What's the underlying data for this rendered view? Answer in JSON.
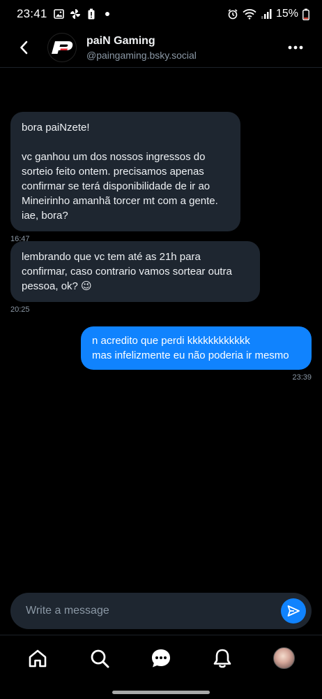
{
  "status_bar": {
    "time": "23:41",
    "battery_percent": "15%",
    "left_icons": [
      "gallery-icon",
      "pinwheel-icon",
      "battery-alert-icon",
      "dot-icon"
    ],
    "right_icons": [
      "alarm-icon",
      "wifi-icon",
      "signal-icon",
      "battery-icon"
    ]
  },
  "header": {
    "name": "paiN Gaming",
    "handle": "@paingaming.bsky.social",
    "logo_text": "P"
  },
  "messages": [
    {
      "direction": "incoming",
      "text": "bora paiNzete!\n\nvc ganhou um dos nossos ingressos do sorteio feito ontem. precisamos apenas confirmar se terá disponibilidade de ir ao Mineirinho amanhã torcer mt com a gente. iae, bora?",
      "time": "16:47"
    },
    {
      "direction": "incoming",
      "text": "lembrando que vc tem até as 21h para confirmar, caso contrario vamos sortear outra pessoa, ok? 😉",
      "time": "20:25"
    },
    {
      "direction": "outgoing",
      "text": "n acredito que perdi kkkkkkkkkkkk\nmas infelizmente eu não poderia ir mesmo",
      "time": "23:39"
    }
  ],
  "composer": {
    "placeholder": "Write a message"
  },
  "bottom_nav": [
    "home-icon",
    "search-icon",
    "chat-icon",
    "notifications-icon",
    "profile-avatar"
  ],
  "colors": {
    "background": "#000000",
    "incoming_bubble": "#1e2630",
    "outgoing_bubble": "#1083fe",
    "muted_text": "#8b98a5"
  }
}
